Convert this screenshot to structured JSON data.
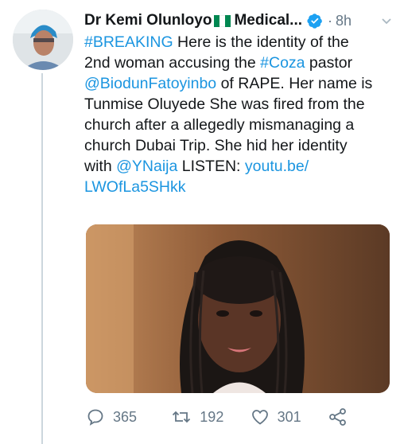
{
  "tweet": {
    "author_name": "Dr Kemi Olunloyo",
    "author_name_suffix": "Medical...",
    "separator": "·",
    "time": "8h",
    "lines": [
      [
        {
          "t": "#BREAKING",
          "link": true
        },
        {
          "t": " Here is the identity of the",
          "link": false
        }
      ],
      [
        {
          "t": "2nd woman accusing the ",
          "link": false
        },
        {
          "t": "#Coza",
          "link": true
        },
        {
          "t": " pastor",
          "link": false
        }
      ],
      [
        {
          "t": "@BiodunFatoyinbo",
          "link": true
        },
        {
          "t": " of RAPE. Her name is",
          "link": false
        }
      ],
      [
        {
          "t": "Tunmise Oluyede She was fired from the",
          "link": false
        }
      ],
      [
        {
          "t": "church after a allegedly mismanaging a",
          "link": false
        }
      ],
      [
        {
          "t": "church Dubai Trip. She hid her identity",
          "link": false
        }
      ],
      [
        {
          "t": "with ",
          "link": false
        },
        {
          "t": "@YNaija",
          "link": true
        },
        {
          "t": " LISTEN: ",
          "link": false
        },
        {
          "t": "youtu.be/",
          "link": true
        }
      ],
      [
        {
          "t": "LWOfLa5SHkk",
          "link": true
        }
      ]
    ],
    "actions": {
      "reply_count": "365",
      "retweet_count": "192",
      "like_count": "301"
    }
  },
  "colors": {
    "link": "#1b95e0",
    "muted": "#657786",
    "verified": "#1da1f2",
    "flag_green": "#008751"
  }
}
